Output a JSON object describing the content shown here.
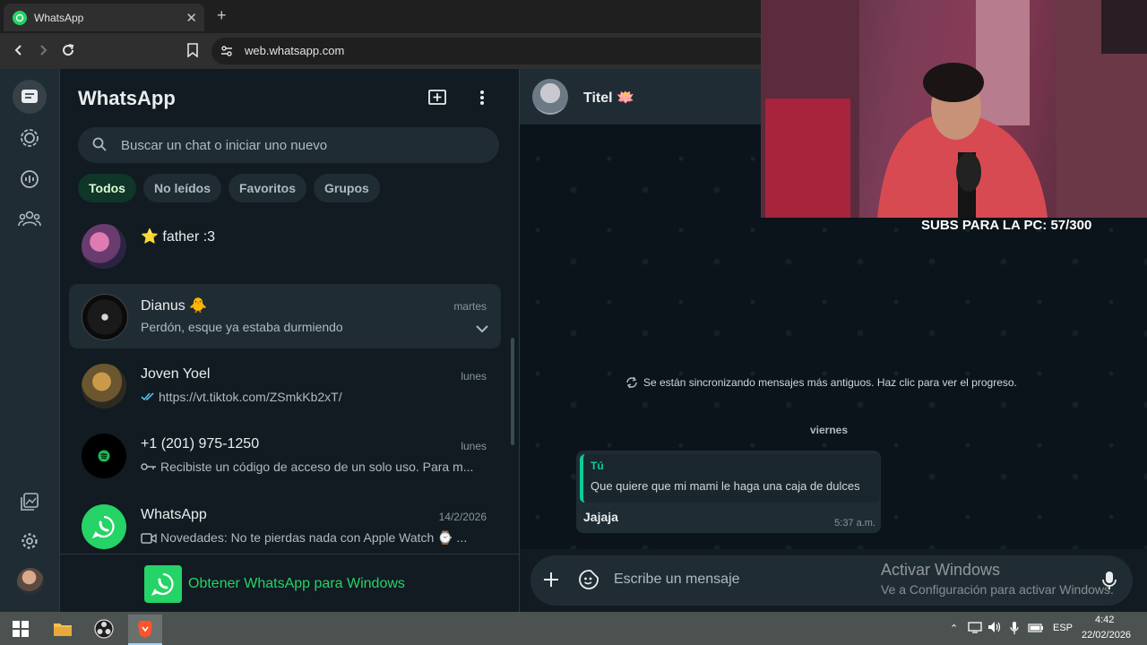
{
  "browser": {
    "tab_title": "WhatsApp",
    "url": "web.whatsapp.com"
  },
  "sidebar": {
    "title": "WhatsApp",
    "search_placeholder": "Buscar un chat o iniciar uno nuevo",
    "filters": [
      {
        "label": "Todos",
        "active": true
      },
      {
        "label": "No leídos",
        "active": false
      },
      {
        "label": "Favoritos",
        "active": false
      },
      {
        "label": "Grupos",
        "active": false
      }
    ],
    "chats": [
      {
        "name": "⭐ father :3",
        "time": "",
        "preview": ""
      },
      {
        "name": "Dianus 🐥",
        "time": "martes",
        "preview": "Perdón, esque ya estaba durmiendo"
      },
      {
        "name": "Joven Yoel",
        "time": "lunes",
        "preview": "https://vt.tiktok.com/ZSmkKb2xT/"
      },
      {
        "name": "+1 (201) 975-1250",
        "time": "lunes",
        "preview": "Recibiste un código de acceso de un solo uso. Para m..."
      },
      {
        "name": "WhatsApp",
        "time": "14/2/2026",
        "preview": "Novedades: No te pierdas nada con Apple Watch ⌚ ..."
      }
    ],
    "get_app": "Obtener WhatsApp para Windows"
  },
  "conversation": {
    "contact_name": "Titel 🪷",
    "sync_notice": "Se están sincronizando mensajes más antiguos. Haz clic para ver el progreso.",
    "day_label": "viernes",
    "message": {
      "quote_author": "Tú",
      "quote_text": "Que quiere que mi mami le haga una caja de dulces",
      "text": "Jajaja",
      "time": "5:37 a.m."
    },
    "composer_placeholder": "Escribe un mensaje"
  },
  "overlay": {
    "activate_title": "Activar Windows",
    "activate_sub": "Ve a Configuración para activar Windows.",
    "subs": "SUBS PARA LA PC: 57/300"
  },
  "taskbar": {
    "lang": "ESP",
    "time": "4:42",
    "date": "22/02/2026"
  },
  "colors": {
    "accent": "#25d366",
    "panel": "#202c33",
    "background": "#111b21"
  }
}
